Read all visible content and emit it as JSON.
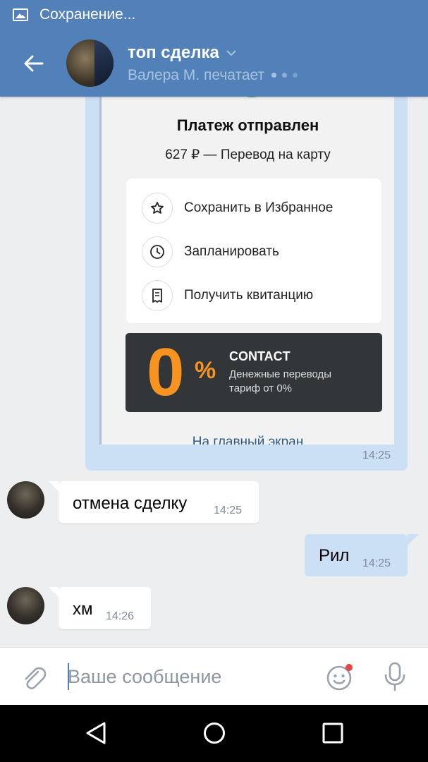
{
  "status_bar": {
    "text": "Сохранение..."
  },
  "header": {
    "title": "топ сделка",
    "typing": "Валера М. печатает"
  },
  "screenshot": {
    "title": "Платеж отправлен",
    "subtitle": "627 ₽ — Перевод на карту",
    "actions": [
      {
        "label": "Сохранить в Избранное",
        "icon": "star-icon"
      },
      {
        "label": "Запланировать",
        "icon": "clock-icon"
      },
      {
        "label": "Получить квитанцию",
        "icon": "receipt-icon"
      }
    ],
    "promo": {
      "big": "0",
      "pct": "%",
      "title": "CONTACT",
      "line1": "Денежные переводы",
      "line2": "тариф от 0%"
    },
    "home_link": "На главный экран",
    "time": "14:25"
  },
  "messages": [
    {
      "direction": "in",
      "text": "отмена сделку",
      "time": "14:25"
    },
    {
      "direction": "out",
      "text": "Рил",
      "time": "14:25"
    },
    {
      "direction": "in",
      "text": "хм",
      "time": "14:26"
    }
  ],
  "composer": {
    "placeholder": "Ваше сообщение"
  },
  "colors": {
    "accent": "#5181b8",
    "outgoing_bubble": "#cce0f5",
    "background": "#edeef0",
    "promo_orange": "#f7931e"
  }
}
